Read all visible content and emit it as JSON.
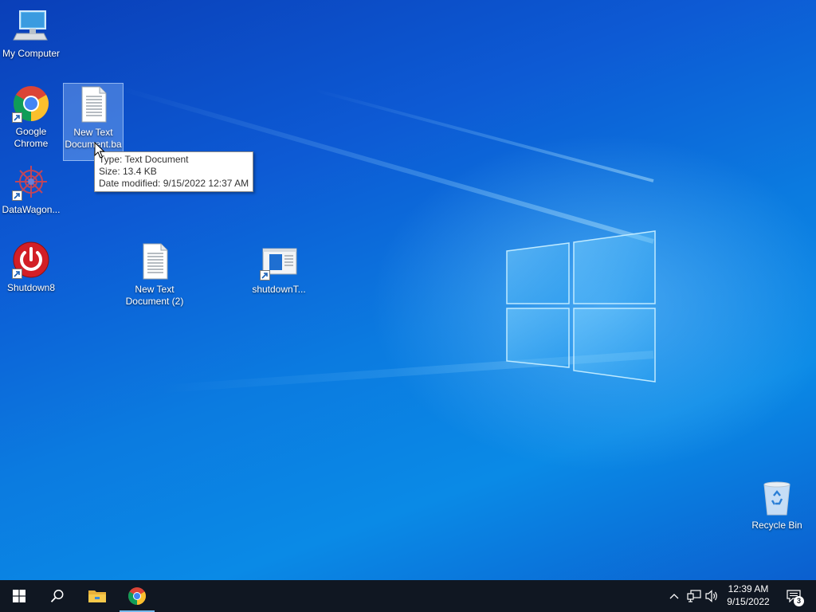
{
  "desktop": {
    "icons": [
      {
        "id": "my-computer",
        "label": "My Computer",
        "shortcut": false
      },
      {
        "id": "google-chrome",
        "label": "Google Chrome",
        "shortcut": true
      },
      {
        "id": "new-text-document-ba",
        "label": "New Text Document.ba",
        "shortcut": false,
        "selected": true
      },
      {
        "id": "datawagon",
        "label": "DataWagon...",
        "shortcut": true
      },
      {
        "id": "shutdown8",
        "label": "Shutdown8",
        "shortcut": true
      },
      {
        "id": "new-text-document-2",
        "label": "New Text Document (2)",
        "shortcut": false
      },
      {
        "id": "shutdownt",
        "label": "shutdownT...",
        "shortcut": true
      },
      {
        "id": "recycle-bin",
        "label": "Recycle Bin",
        "shortcut": false
      }
    ],
    "tooltip": {
      "type": "Type: Text Document",
      "size": "Size: 13.4 KB",
      "date_modified": "Date modified: 9/15/2022 12:37 AM"
    }
  },
  "taskbar": {
    "start_icon": "windows-logo-icon",
    "search_icon": "search-icon",
    "pinned": [
      {
        "id": "file-explorer",
        "icon": "folder-icon",
        "active": false
      },
      {
        "id": "chrome",
        "icon": "chrome-icon",
        "active": true
      }
    ],
    "tray": {
      "overflow_icon": "chevron-up-icon",
      "network_icon": "network-icon",
      "volume_icon": "speaker-icon",
      "time": "12:39 AM",
      "date": "9/15/2022",
      "notification_count": "3"
    }
  },
  "colors": {
    "taskbar": "#101722",
    "accent": "#76b9ed",
    "desktop_blue": "#0b7be0"
  }
}
